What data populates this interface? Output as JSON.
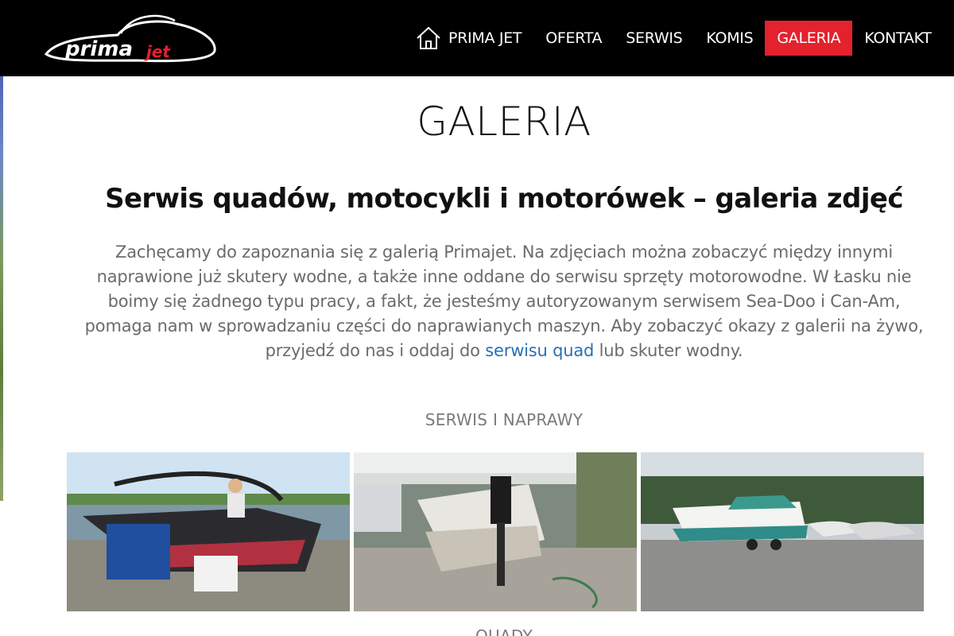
{
  "brand": {
    "logo_name": "prima",
    "logo_suffix": "jet"
  },
  "nav": {
    "items": [
      {
        "label": "PRIMA JET",
        "icon": "home-icon"
      },
      {
        "label": "OFERTA"
      },
      {
        "label": "SERWIS"
      },
      {
        "label": "KOMIS"
      },
      {
        "label": "GALERIA",
        "active": true
      },
      {
        "label": "KONTAKT"
      }
    ]
  },
  "colors": {
    "header_bg": "#000000",
    "active_bg": "#e3222d",
    "link": "#2a6fb5",
    "body_text": "#6b6b6b"
  },
  "page": {
    "title": "GALERIA",
    "subtitle": "Serwis quadów, motocykli i motorówek – galeria zdjęć",
    "intro_before_link": "Zachęcamy do zapoznania się z galerią Primajet. Na zdjęciach można zobaczyć między innymi naprawione już skutery wodne, a także inne oddane do serwisu sprzęty motorowodne. W Łasku nie boimy się żadnego typu pracy, a fakt, że jesteśmy autoryzowanym serwisem Sea-Doo i Can-Am, pomaga nam w sprowadzaniu części do naprawianych maszyn. Aby zobaczyć okazy z galerii na żywo, przyjedź do nas i oddaj do ",
    "intro_link": "serwisu quad",
    "intro_after_link": " lub skuter wodny."
  },
  "sections": [
    {
      "label": "SERWIS I NAPRAWY"
    },
    {
      "label": "QUADY"
    }
  ]
}
